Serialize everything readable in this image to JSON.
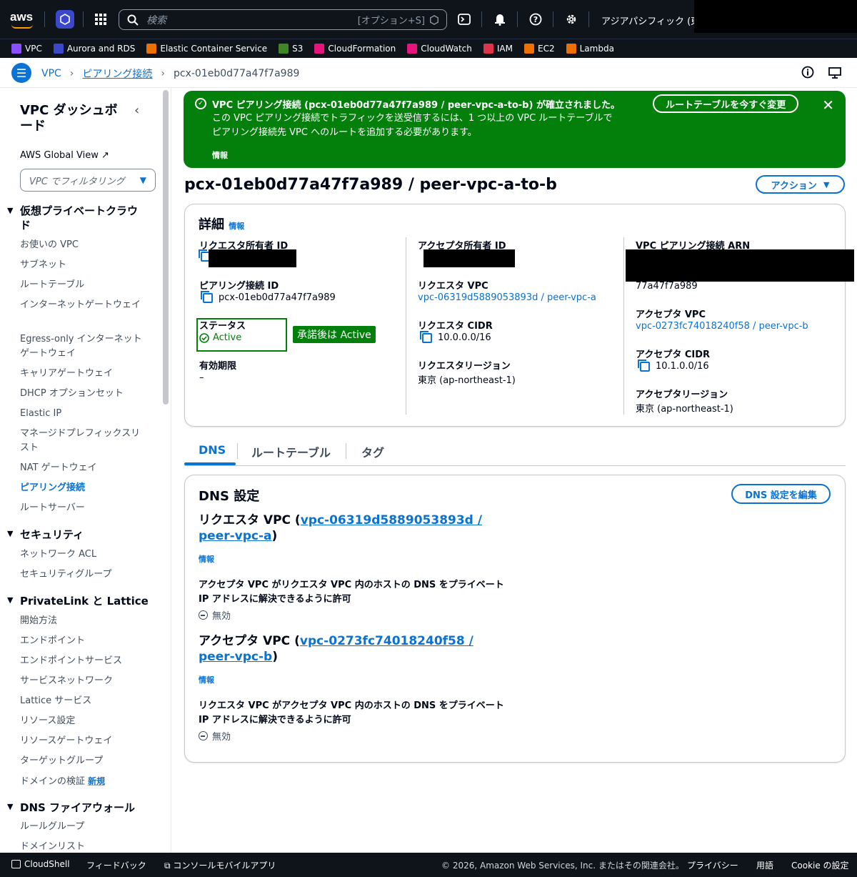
{
  "topbar": {
    "search_placeholder": "検索",
    "search_shortcut": "[オプション+S]",
    "region": "アジアパシフィック (東京)"
  },
  "favorites": [
    {
      "label": "VPC",
      "color": "#8c4fff"
    },
    {
      "label": "Aurora and RDS",
      "color": "#3b48cc"
    },
    {
      "label": "Elastic Container Service",
      "color": "#ed7100"
    },
    {
      "label": "S3",
      "color": "#3f8624"
    },
    {
      "label": "CloudFormation",
      "color": "#e7157b"
    },
    {
      "label": "CloudWatch",
      "color": "#e7157b"
    },
    {
      "label": "IAM",
      "color": "#dd344c"
    },
    {
      "label": "EC2",
      "color": "#ed7100"
    },
    {
      "label": "Lambda",
      "color": "#ed7100"
    }
  ],
  "breadcrumb": {
    "root": "VPC",
    "parent": "ピアリング接続",
    "current": "pcx-01eb0d77a47f7a989"
  },
  "sidebar": {
    "title": "VPC ダッシュボード",
    "global_view": "AWS Global View",
    "filter": "VPC でフィルタリング",
    "sections": [
      {
        "title": "仮想プライベートクラウド",
        "items": [
          "お使いの VPC",
          "サブネット",
          "ルートテーブル",
          "インターネットゲートウェイ",
          "Egress-only インターネットゲートウェイ",
          "キャリアゲートウェイ",
          "DHCP オプションセット",
          "Elastic IP",
          "マネージドプレフィックスリスト",
          "NAT ゲートウェイ",
          "ピアリング接続",
          "ルートサーバー"
        ]
      },
      {
        "title": "セキュリティ",
        "items": [
          "ネットワーク ACL",
          "セキュリティグループ"
        ]
      },
      {
        "title": "PrivateLink と Lattice",
        "items": [
          "開始方法",
          "エンドポイント",
          "エンドポイントサービス",
          "サービスネットワーク",
          "Lattice サービス",
          "リソース設定",
          "リソースゲートウェイ",
          "ターゲットグループ",
          "ドメインの検証"
        ]
      },
      {
        "title": "DNS ファイアウォール",
        "items": [
          "ルールグループ",
          "ドメインリスト"
        ]
      }
    ],
    "new_badge": "新規"
  },
  "banner": {
    "title": "VPC ピアリング接続 (pcx-01eb0d77a47f7a989 / peer-vpc-a-to-b) が確立されました。",
    "body1": "この VPC ピアリング接続でトラフィックを送受信するには、1 つ以上の VPC ルートテーブルで",
    "body2": "ピアリング接続先 VPC へのルートを追加する必要があります。",
    "info": "情報",
    "button": "ルートテーブルを今すぐ変更"
  },
  "page": {
    "title": "pcx-01eb0d77a47f7a989 / peer-vpc-a-to-b",
    "actions": "アクション"
  },
  "details": {
    "title": "詳細",
    "info": "情報",
    "requester_owner_label": "リクエスタ所有者 ID",
    "peering_id_label": "ピアリング接続 ID",
    "peering_id": "pcx-01eb0d77a47f7a989",
    "status_label": "ステータス",
    "status": "Active",
    "expiry_label": "有効期限",
    "expiry": "–",
    "accepter_owner_label": "アクセプタ所有者 ID",
    "requester_vpc_label": "リクエスタ VPC",
    "requester_vpc": "vpc-06319d5889053893d / peer-vpc-a",
    "requester_cidr_label": "リクエスタ CIDR",
    "requester_cidr": "10.0.0.0/16",
    "requester_region_label": "リクエスタリージョン",
    "requester_region": "東京 (ap-northeast-1)",
    "arn_label": "VPC ピアリング接続 ARN",
    "arn_tail": "77a47f7a989",
    "accepter_vpc_label": "アクセプタ VPC",
    "accepter_vpc": "vpc-0273fc74018240f58 / peer-vpc-b",
    "accepter_cidr_label": "アクセプタ CIDR",
    "accepter_cidr": "10.1.0.0/16",
    "accepter_region_label": "アクセプタリージョン",
    "accepter_region": "東京 (ap-northeast-1)",
    "annotation": "承諾後は Active"
  },
  "tabs": [
    "DNS",
    "ルートテーブル",
    "タグ"
  ],
  "dns": {
    "title": "DNS 設定",
    "edit": "DNS 設定を編集",
    "req_prefix": "リクエスタ VPC (",
    "req_link": "vpc-06319d5889053893d / peer-vpc-a",
    "req_suffix": ")",
    "info": "情報",
    "req_desc": "アクセプタ VPC がリクエスタ VPC 内のホストの DNS をプライベート IP アドレスに解決できるように許可",
    "disabled": "無効",
    "acc_prefix": "アクセプタ VPC (",
    "acc_link": "vpc-0273fc74018240f58 / peer-vpc-b",
    "acc_suffix": ")",
    "acc_desc": "リクエスタ VPC がアクセプタ VPC 内のホストの DNS をプライベート IP アドレスに解決できるように許可"
  },
  "footer": {
    "cloudshell": "CloudShell",
    "feedback": "フィードバック",
    "mobile": "コンソールモバイルアプリ",
    "copyright": "© 2026, Amazon Web Services, Inc. またはその関連会社。",
    "privacy": "プライバシー",
    "terms": "用語",
    "cookie": "Cookie の設定"
  }
}
